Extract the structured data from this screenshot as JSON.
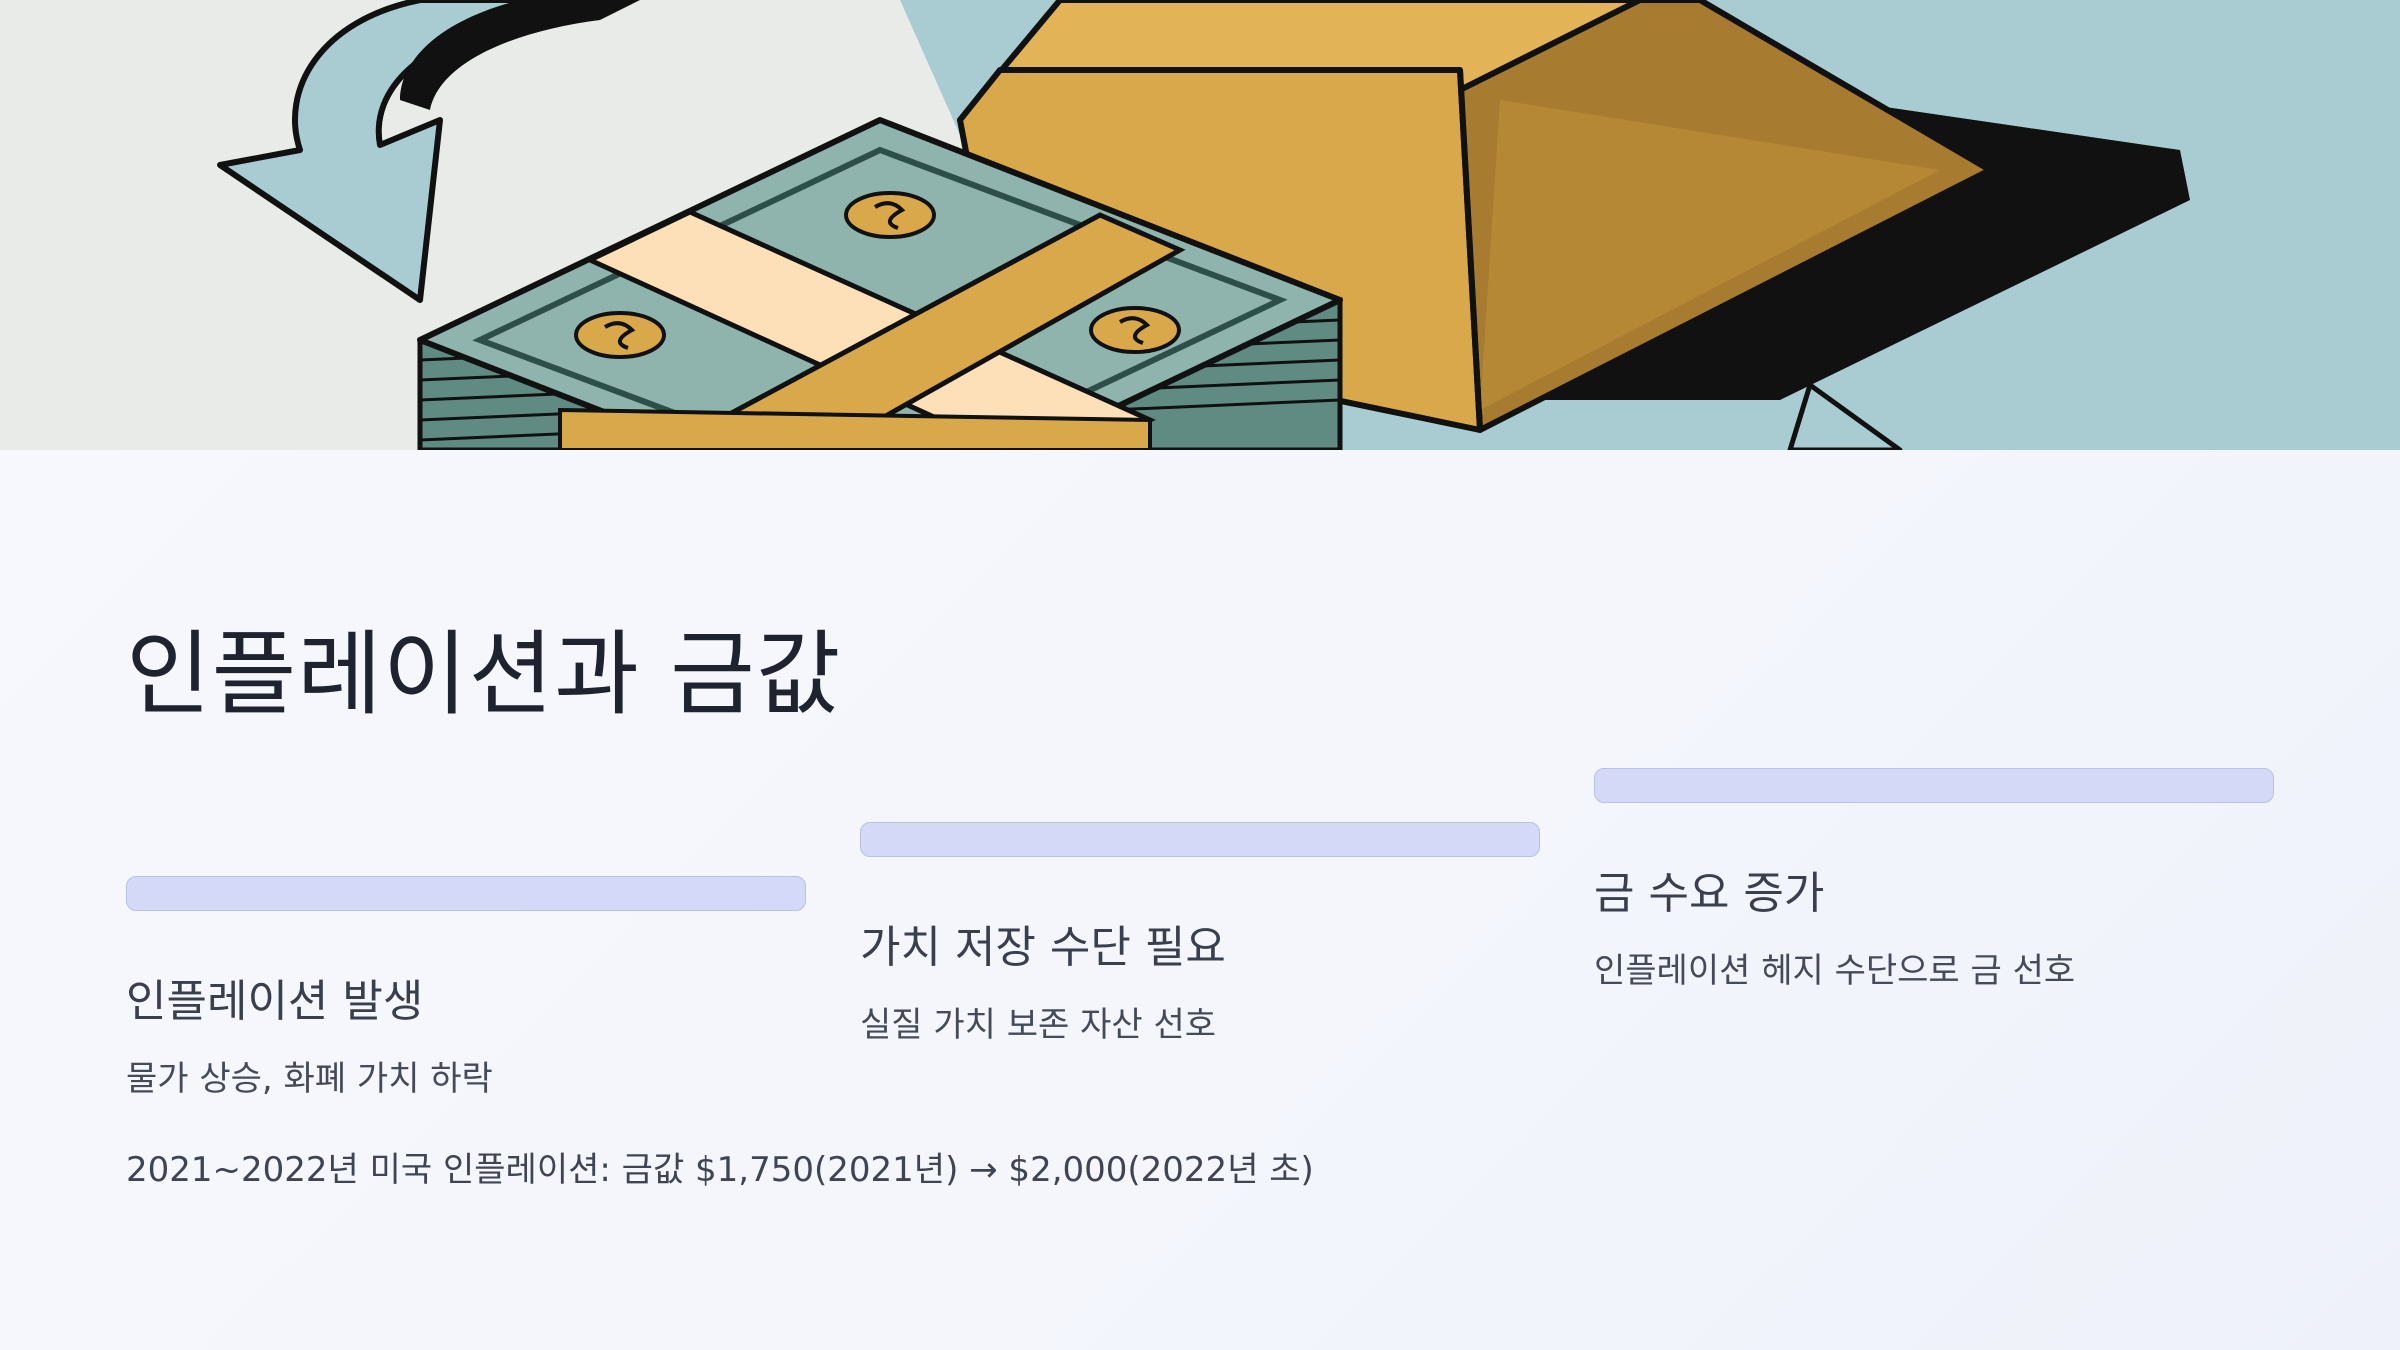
{
  "slide": {
    "title": "인플레이션과 금값",
    "steps": [
      {
        "title": "인플레이션 발생",
        "description": "물가 상승, 화폐 가치 하락"
      },
      {
        "title": "가치 저장 수단 필요",
        "description": "실질 가치 보존 자산 선호"
      },
      {
        "title": "금 수요 증가",
        "description": "인플레이션 헤지 수단으로 금 선호"
      }
    ],
    "footnote": "2021~2022년 미국 인플레이션: 금값 $1,750(2021년) → $2,000(2022년 초)"
  },
  "hero_image": {
    "subject": "gold bar and stack of dollar bills with exchange arrows",
    "colors": {
      "gold": "#d9a84a",
      "gold_dark": "#a87c30",
      "money": "#8fb4ad",
      "band": "#fde0b8",
      "sky": "#a8ccd2",
      "background": "#e9ebe8"
    }
  }
}
